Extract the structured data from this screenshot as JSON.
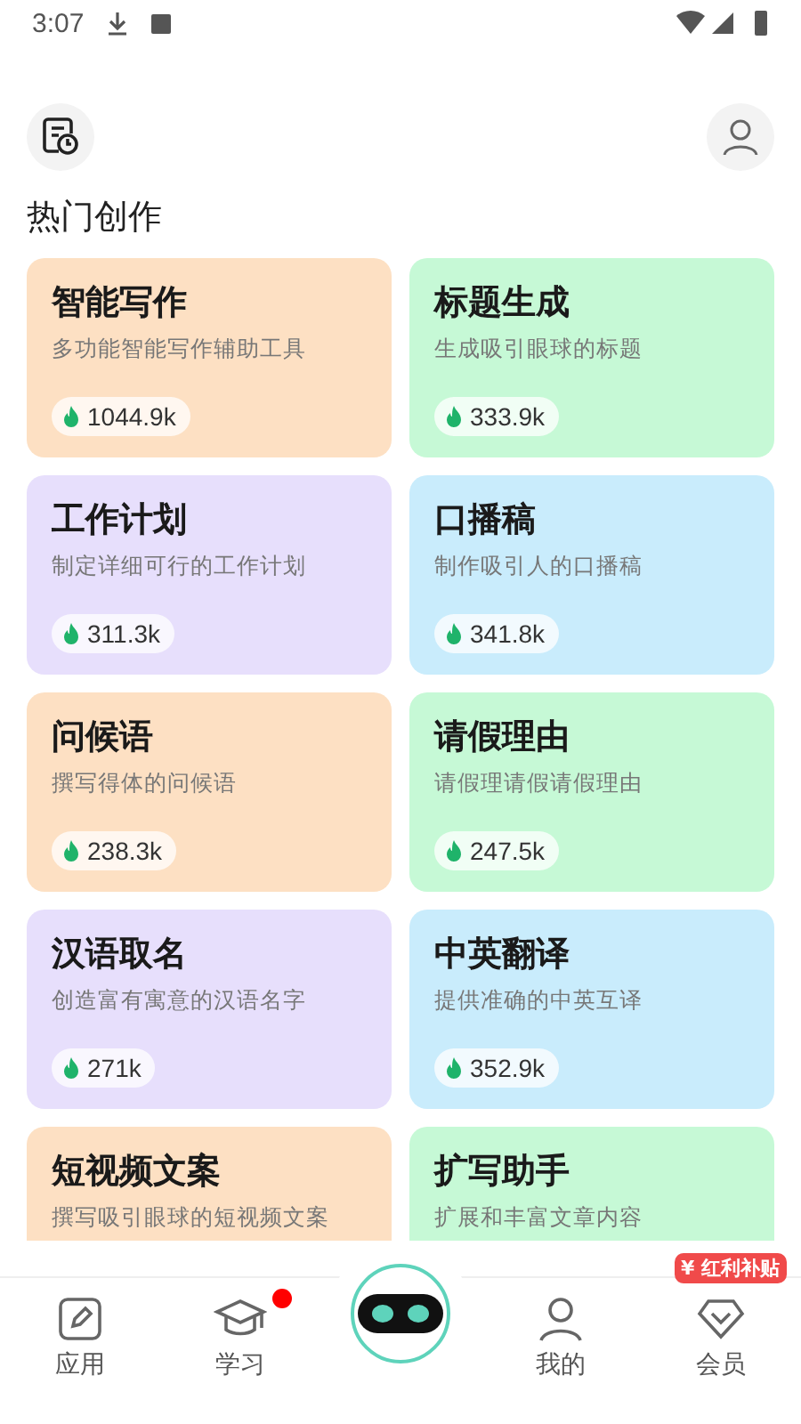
{
  "status_bar": {
    "time": "3:07"
  },
  "section_title": "热门创作",
  "cards": [
    {
      "title": "智能写作",
      "description": "多功能智能写作辅助工具",
      "stat": "1044.9k",
      "color": "#fde0c3"
    },
    {
      "title": "标题生成",
      "description": "生成吸引眼球的标题",
      "stat": "333.9k",
      "color": "#c6f9d6"
    },
    {
      "title": "工作计划",
      "description": "制定详细可行的工作计划",
      "stat": "311.3k",
      "color": "#e7dffc"
    },
    {
      "title": "口播稿",
      "description": "制作吸引人的口播稿",
      "stat": "341.8k",
      "color": "#c9ecfc"
    },
    {
      "title": "问候语",
      "description": "撰写得体的问候语",
      "stat": "238.3k",
      "color": "#fde0c3"
    },
    {
      "title": "请假理由",
      "description": "请假理请假请假理由",
      "stat": "247.5k",
      "color": "#c6f9d6"
    },
    {
      "title": "汉语取名",
      "description": "创造富有寓意的汉语名字",
      "stat": "271k",
      "color": "#e7dffc"
    },
    {
      "title": "中英翻译",
      "description": "提供准确的中英互译",
      "stat": "352.9k",
      "color": "#c9ecfc"
    },
    {
      "title": "短视频文案",
      "description": "撰写吸引眼球的短视频文案",
      "color": "#fde0c3"
    },
    {
      "title": "扩写助手",
      "description": "扩展和丰富文章内容",
      "color": "#c6f9d6"
    }
  ],
  "bottom_nav": {
    "items": [
      {
        "kind": "pencil",
        "label": "应用",
        "dot": false
      },
      {
        "kind": "cap",
        "label": "学习",
        "dot": true
      },
      {
        "kind": "robot"
      },
      {
        "kind": "person",
        "label": "我的",
        "dot": false
      },
      {
        "kind": "diamond",
        "label": "会员",
        "dot": false,
        "tag_icon": "¥",
        "tag": "红利补贴"
      }
    ]
  }
}
